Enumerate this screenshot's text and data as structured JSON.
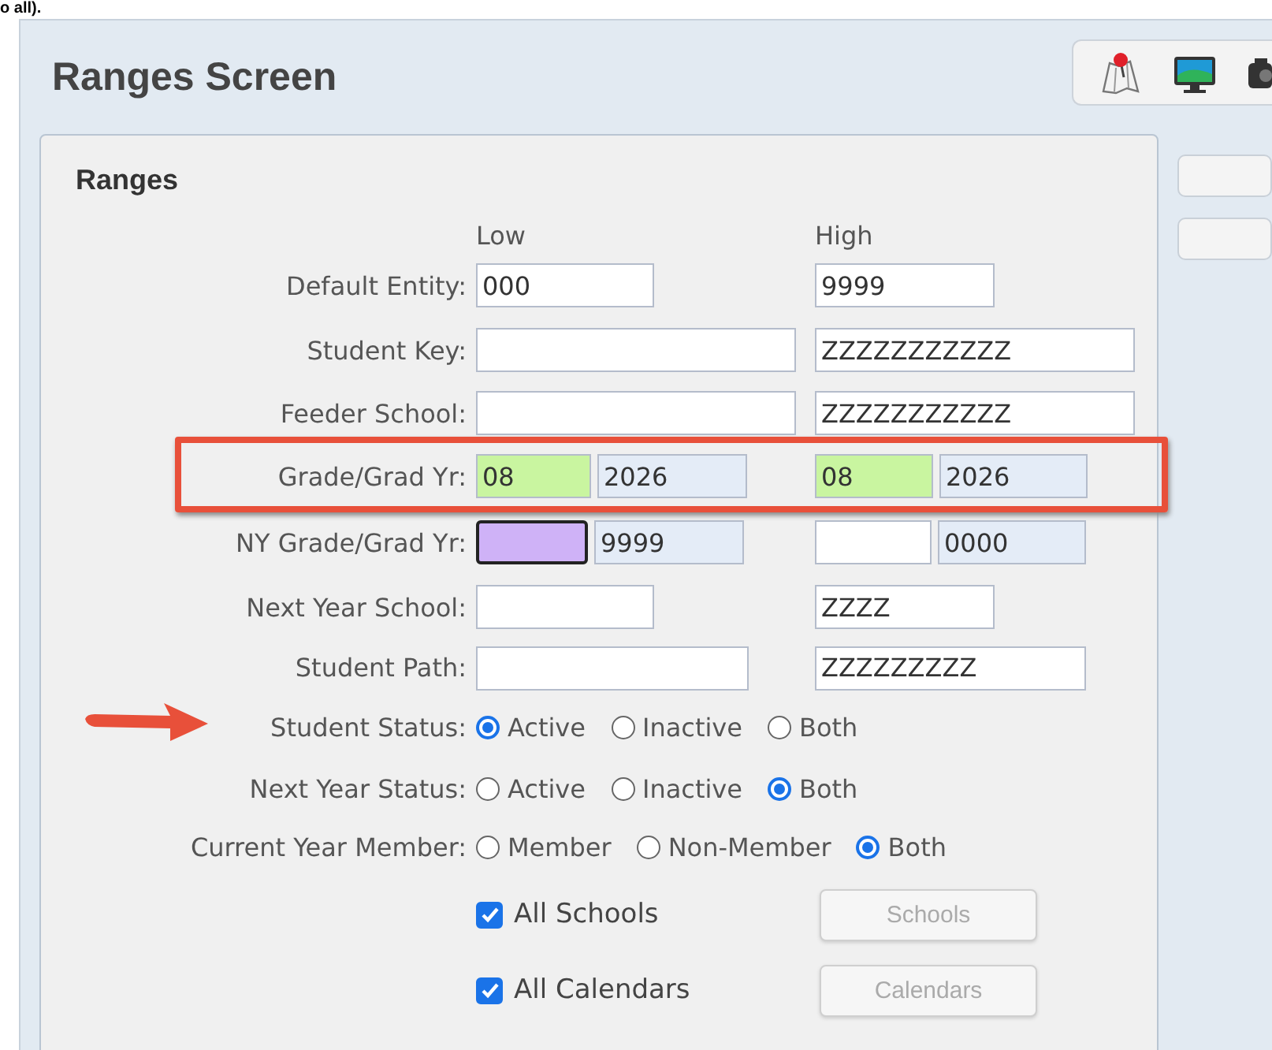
{
  "caption_fragment": "o all).",
  "window": {
    "title": "Ranges Screen"
  },
  "panel": {
    "title": "Ranges",
    "low_heading": "Low",
    "high_heading": "High",
    "rows": [
      {
        "kind": "fields",
        "label": "Default Entity:",
        "low": [
          {
            "value": "000",
            "color": "#ffffff"
          }
        ],
        "high": [
          {
            "value": "9999",
            "color": "#ffffff"
          }
        ]
      },
      {
        "kind": "fields",
        "label": "Student Key:",
        "low": [
          {
            "color": "#ffffff"
          }
        ],
        "high": [
          {
            "value": "ZZZZZZZZZZZ",
            "color": "#ffffff"
          }
        ]
      },
      {
        "kind": "fields",
        "label": "Feeder School:",
        "low": [
          {
            "color": "#ffffff"
          }
        ],
        "high": [
          {
            "value": "ZZZZZZZZZZZ",
            "color": "#ffffff"
          }
        ]
      },
      {
        "kind": "fields",
        "label": "Grade/Grad Yr:",
        "highlighted": true,
        "low": [
          {
            "value": "08",
            "color": "#c9f5a0"
          },
          {
            "value": "2026",
            "color": "#e4ecf7"
          }
        ],
        "high": [
          {
            "value": "08",
            "color": "#c9f5a0"
          },
          {
            "value": "2026",
            "color": "#e4ecf7"
          }
        ]
      },
      {
        "kind": "fields",
        "label": "NY Grade/Grad Yr:",
        "low": [
          {
            "color": "#cfb2f7",
            "focused": true
          },
          {
            "value": "9999",
            "color": "#e4ecf7"
          }
        ],
        "high": [
          {
            "color": "#ffffff"
          },
          {
            "value": "0000",
            "color": "#e4ecf7"
          }
        ]
      },
      {
        "kind": "fields",
        "label": "Next Year School:",
        "low": [
          {
            "color": "#ffffff"
          }
        ],
        "high": [
          {
            "value": "ZZZZ",
            "color": "#ffffff"
          }
        ]
      },
      {
        "kind": "fields",
        "label": "Student Path:",
        "low": [
          {
            "color": "#ffffff"
          }
        ],
        "high": [
          {
            "value": "ZZZZZZZZZ",
            "color": "#ffffff"
          }
        ]
      },
      {
        "kind": "radios",
        "label": "Student Status:",
        "pointed_at": true,
        "options": [
          {
            "label": "Active",
            "selected": true
          },
          {
            "label": "Inactive",
            "selected": false
          },
          {
            "label": "Both",
            "selected": false
          }
        ]
      },
      {
        "kind": "radios",
        "label": "Next Year Status:",
        "options": [
          {
            "label": "Active",
            "selected": false
          },
          {
            "label": "Inactive",
            "selected": false
          },
          {
            "label": "Both",
            "selected": true
          }
        ]
      },
      {
        "kind": "radios",
        "label": "Current Year Member:",
        "options": [
          {
            "label": "Member",
            "selected": false
          },
          {
            "label": "Non-Member",
            "selected": false
          },
          {
            "label": "Both",
            "selected": true
          }
        ]
      },
      {
        "kind": "checkbox",
        "label": "All Schools",
        "checked": true,
        "button": {
          "label": "Schools",
          "disabled": true
        }
      },
      {
        "kind": "checkbox",
        "label": "All Calendars",
        "checked": true,
        "button": {
          "label": "Calendars",
          "disabled": true
        }
      }
    ]
  }
}
